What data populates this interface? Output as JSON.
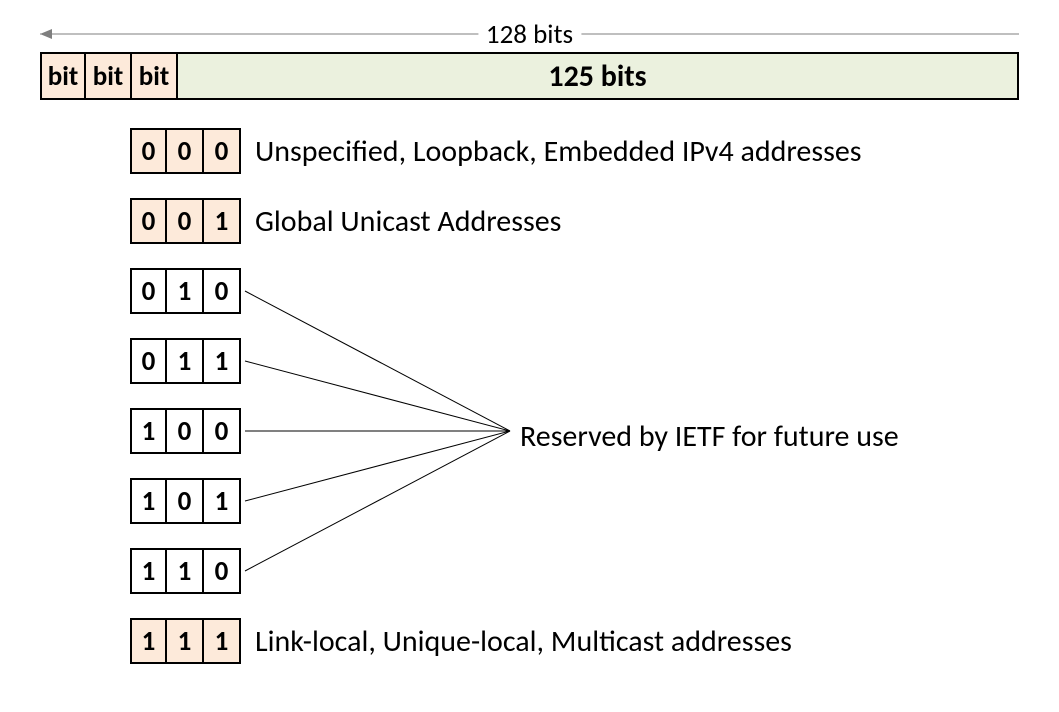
{
  "dimension_label": "128 bits",
  "address_bar": {
    "bit_label": "bit",
    "rest_label": "125 bits"
  },
  "rows": [
    {
      "bits": [
        "0",
        "0",
        "0"
      ],
      "hl": [
        true,
        true,
        true
      ],
      "desc": "Unspecified, Loopback, Embedded IPv4 addresses"
    },
    {
      "bits": [
        "0",
        "0",
        "1"
      ],
      "hl": [
        true,
        true,
        true
      ],
      "desc": "Global Unicast Addresses"
    },
    {
      "bits": [
        "0",
        "1",
        "0"
      ],
      "hl": [
        false,
        false,
        false
      ],
      "desc": ""
    },
    {
      "bits": [
        "0",
        "1",
        "1"
      ],
      "hl": [
        false,
        false,
        false
      ],
      "desc": ""
    },
    {
      "bits": [
        "1",
        "0",
        "0"
      ],
      "hl": [
        false,
        false,
        false
      ],
      "desc": ""
    },
    {
      "bits": [
        "1",
        "0",
        "1"
      ],
      "hl": [
        false,
        false,
        false
      ],
      "desc": ""
    },
    {
      "bits": [
        "1",
        "1",
        "0"
      ],
      "hl": [
        false,
        false,
        false
      ],
      "desc": ""
    },
    {
      "bits": [
        "1",
        "1",
        "1"
      ],
      "hl": [
        true,
        true,
        true
      ],
      "desc": "Link-local, Unique-local, Multicast addresses"
    }
  ],
  "reserved_label": "Reserved by IETF for future use"
}
